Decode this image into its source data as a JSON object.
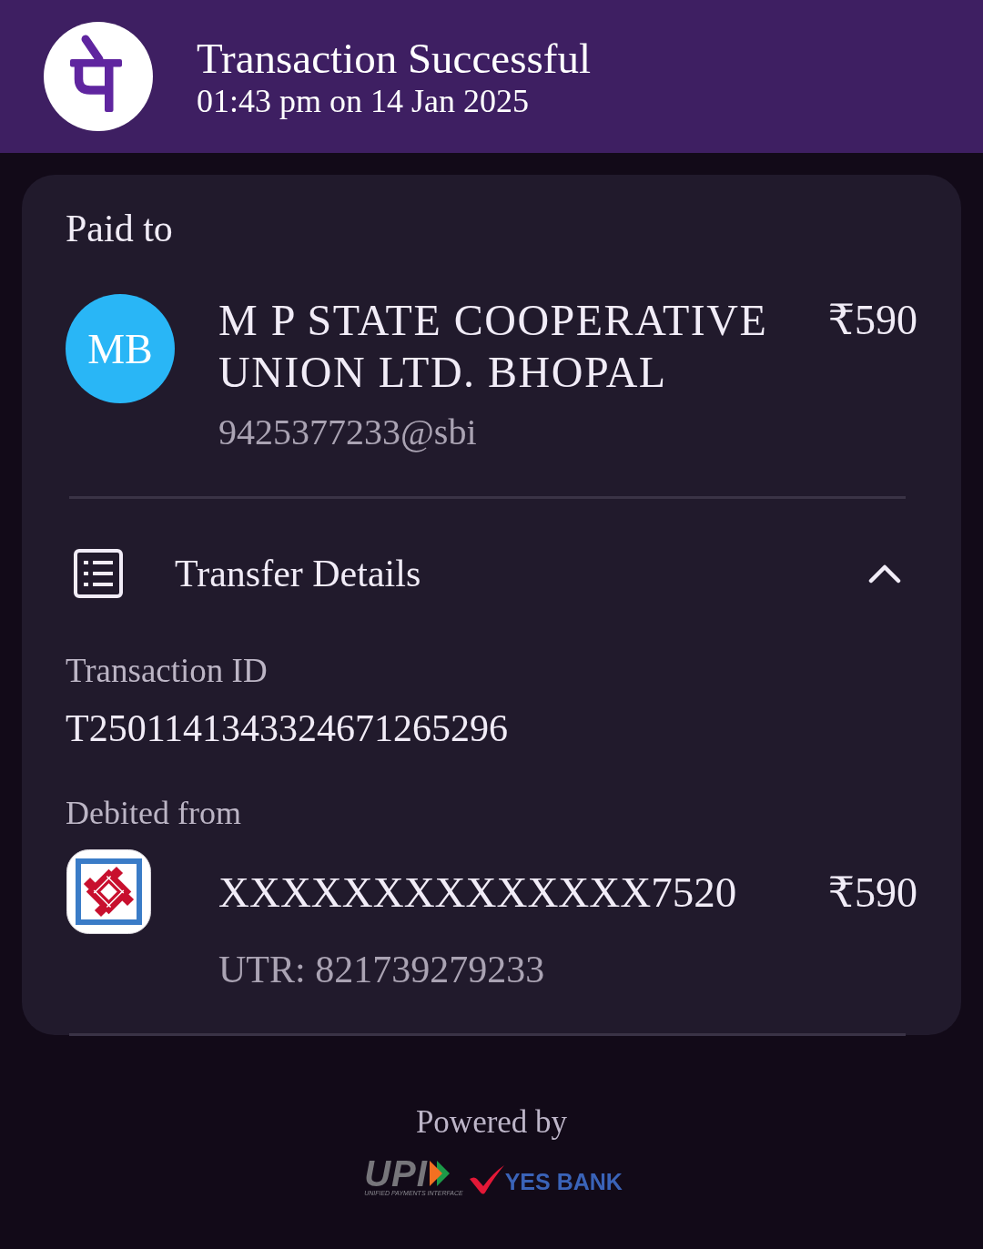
{
  "header": {
    "title": "Transaction Successful",
    "subtitle": "01:43 pm on 14 Jan 2025"
  },
  "paid_to": {
    "label": "Paid to",
    "avatar_initials": "MB",
    "name": "M P STATE COOPERATIVE UNION LTD. BHOPAL",
    "amount": "₹590",
    "upi_id": "9425377233@sbi"
  },
  "transfer_details": {
    "title": "Transfer Details",
    "expanded": true,
    "transaction_id": {
      "label": "Transaction ID",
      "value": "T2501141343324671265296"
    },
    "debited_from": {
      "label": "Debited from",
      "account": "XXXXXXXXXXXXXX7520",
      "amount": "₹590",
      "utr": "UTR: 821739279233"
    }
  },
  "footer": {
    "powered_by": "Powered by",
    "logos": [
      {
        "kind": "upi",
        "text": "UPI",
        "tagline": "UNIFIED PAYMENTS INTERFACE"
      },
      {
        "kind": "bank",
        "text": "YES BANK"
      }
    ]
  }
}
